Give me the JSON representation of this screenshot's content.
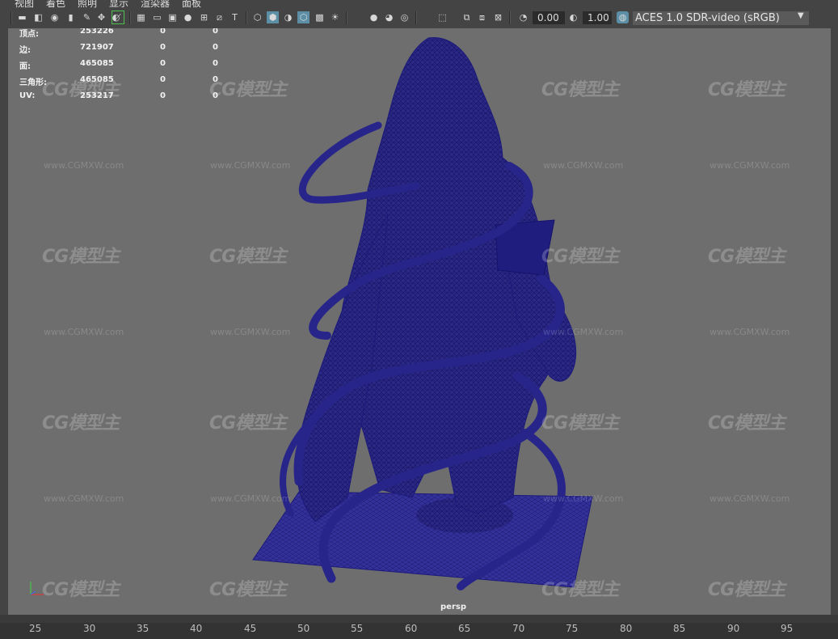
{
  "menu": [
    "视图",
    "着色",
    "照明",
    "显示",
    "渲染器",
    "面板"
  ],
  "toolbar": {
    "exposure_value": "0.00",
    "gamma_value": "1.00",
    "color_space": "ACES 1.0 SDR-video (sRGB)"
  },
  "hud": {
    "rows": [
      {
        "label": "顶点:",
        "v1": "253226",
        "v2": "0",
        "v3": "0"
      },
      {
        "label": "边:",
        "v1": "721907",
        "v2": "0",
        "v3": "0"
      },
      {
        "label": "面:",
        "v1": "465085",
        "v2": "0",
        "v3": "0"
      },
      {
        "label": "三角形:",
        "v1": "465085",
        "v2": "0",
        "v3": "0"
      },
      {
        "label": "UV:",
        "v1": "253217",
        "v2": "0",
        "v3": "0"
      }
    ]
  },
  "viewport": {
    "camera": "persp",
    "wire_color": "#1c1a7a"
  },
  "timeline": {
    "ticks": [
      "25",
      "30",
      "35",
      "40",
      "45",
      "50",
      "55",
      "60",
      "65",
      "70",
      "75",
      "80",
      "85",
      "90",
      "95"
    ]
  },
  "watermark": {
    "logo": "CG模型主",
    "url": "www.CGMXW.com"
  }
}
